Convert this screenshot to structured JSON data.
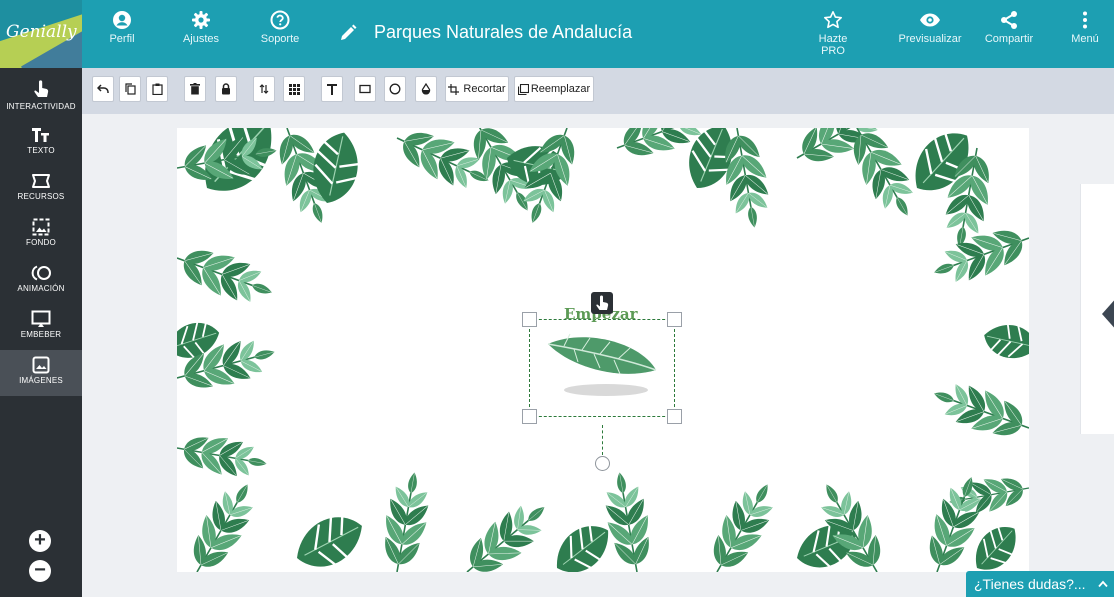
{
  "app": {
    "logo_text": "Genially"
  },
  "topbar": {
    "profile_label": "Perfil",
    "settings_label": "Ajustes",
    "support_label": "Soporte",
    "doc_title": "Parques Naturales de Andalucía",
    "pro_label": "Hazte PRO",
    "preview_label": "Previsualizar",
    "share_label": "Compartir",
    "menu_label": "Menú"
  },
  "sidebar": {
    "items": [
      {
        "label": "INTERACTIVIDAD",
        "icon": "hand-pointer-icon"
      },
      {
        "label": "TEXTO",
        "icon": "text-icon"
      },
      {
        "label": "RECURSOS",
        "icon": "resources-icon"
      },
      {
        "label": "FONDO",
        "icon": "background-icon"
      },
      {
        "label": "ANIMACIÓN",
        "icon": "animation-icon"
      },
      {
        "label": "EMBEBER",
        "icon": "embed-icon"
      },
      {
        "label": "IMÁGENES",
        "icon": "image-icon",
        "active": true
      }
    ],
    "zoom_in": "+",
    "zoom_out": "−"
  },
  "toolbar": {
    "crop_label": "Recortar",
    "replace_label": "Reemplazar"
  },
  "canvas": {
    "button_text": "Empezar"
  },
  "help": {
    "label": "¿Tienes dudas?..."
  },
  "colors": {
    "topbar": "#1d9fb2",
    "sidebar": "#2b3035",
    "toolbar": "#d3d9e3",
    "leaf_dark": "#2e7d4f",
    "leaf_light": "#7cc39a"
  }
}
